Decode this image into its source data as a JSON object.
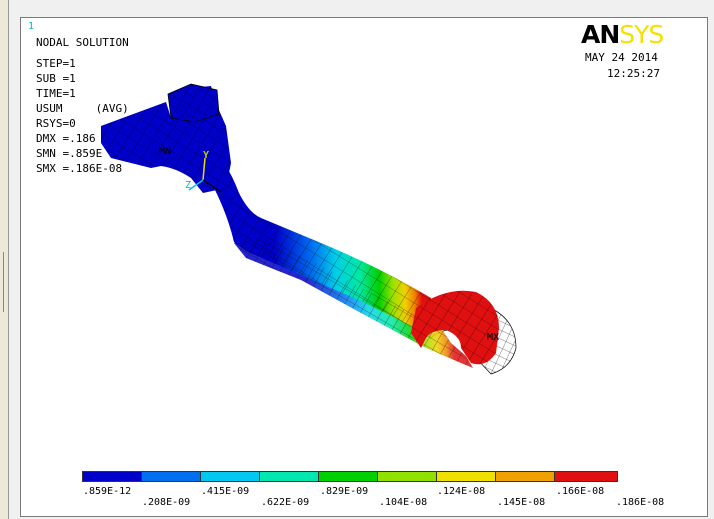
{
  "window_number": "1",
  "logo": {
    "part1": "AN",
    "part2": "SYS"
  },
  "header": {
    "title": "NODAL SOLUTION",
    "date": "MAY 24 2014",
    "time": "12:25:27"
  },
  "info": {
    "step": "STEP=1",
    "sub": "SUB =1",
    "time": "TIME=1",
    "usum": "USUM     (AVG)",
    "rsys": "RSYS=0",
    "dmx": "DMX =.186",
    "smn": "SMN =.859E",
    "smx": "SMX =.186E-08"
  },
  "labels": {
    "mn": "MN",
    "mx": "MX",
    "y_axis": "Y",
    "z_axis": "Z",
    "x_axis": "X"
  },
  "colors": {
    "band1": "#0000c8",
    "band2": "#0070f0",
    "band3": "#00c8f0",
    "band4": "#00e8b0",
    "band5": "#00d000",
    "band6": "#90e000",
    "band7": "#f0e000",
    "band8": "#f0a000",
    "band9": "#e01010"
  },
  "legend": {
    "top": [
      ".859E-12",
      ".415E-09",
      ".829E-09",
      ".124E-08",
      ".166E-08"
    ],
    "bottom": [
      ".208E-09",
      ".622E-09",
      ".104E-08",
      ".145E-08",
      ".186E-08"
    ]
  }
}
